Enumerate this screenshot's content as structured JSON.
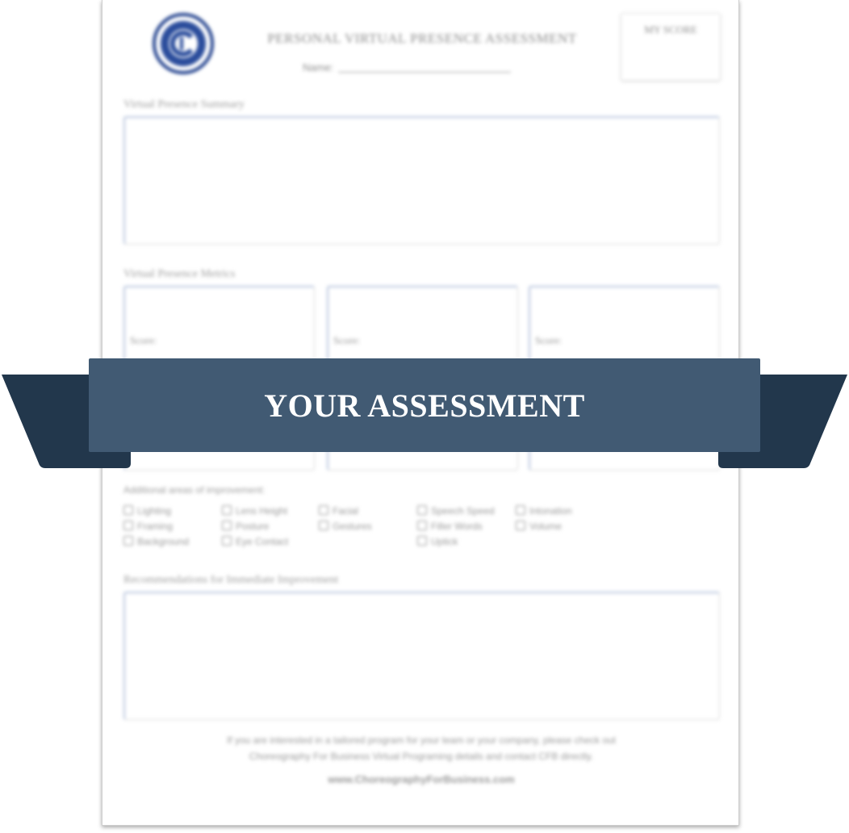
{
  "document": {
    "title": "PERSONAL VIRTUAL PRESENCE ASSESSMENT",
    "name_label": "Name:",
    "score_box_label": "MY SCORE",
    "logo_icon": "cfb-circular-seal-logo",
    "summary_label": "Virtual Presence Summary",
    "metrics_label": "Virtual Presence Metrics",
    "metrics": [
      {
        "score_label": "Score:"
      },
      {
        "score_label": "Score:"
      },
      {
        "score_label": "Score:"
      }
    ],
    "improvement_label": "Additional areas of improvement:",
    "improvement_options": [
      "Lighting",
      "Framing",
      "Background",
      "Lens Height",
      "Posture",
      "Eye Contact",
      "Facial",
      "Gestures",
      "Speech Speed",
      "Filler Words",
      "Uptick",
      "Intonation",
      "Volume"
    ],
    "recommendations_label": "Recommendations for Immediate Improvement",
    "footer_line1": "If you are interested in a tailored program for your team or your company, please check out",
    "footer_line2": "Choreography For Business Virtual Programing details and contact CFB directly.",
    "footer_url": "www.ChoreographyForBusiness.com"
  },
  "banner": {
    "text": "YOUR ASSESSMENT",
    "colors": {
      "front": "#415a73",
      "tail": "#22374c"
    }
  }
}
